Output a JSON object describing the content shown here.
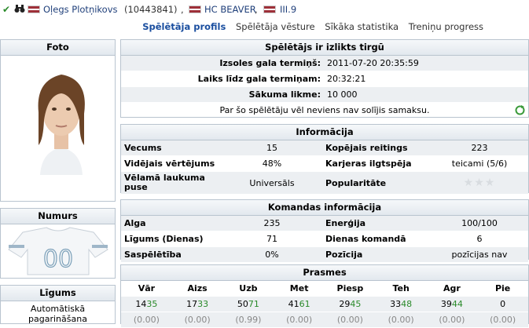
{
  "header": {
    "player_name": "Oļegs Plotņikovs",
    "player_id": "(10443841)",
    "team": "HC BEAVER",
    "league": "III.9",
    "separator": ","
  },
  "tabs": [
    {
      "label": "Spēlētāja profils",
      "active": true
    },
    {
      "label": "Spēlētāja vēsture",
      "active": false
    },
    {
      "label": "Sīkāka statistika",
      "active": false
    },
    {
      "label": "Treniņu progress",
      "active": false
    }
  ],
  "left": {
    "photo_title": "Foto",
    "number_title": "Numurs",
    "contract_title": "Līgums",
    "contract_text_1": "Automātiskā",
    "contract_text_2": "pagarināšana"
  },
  "market": {
    "title": "Spēlētājs ir izlikts tirgū",
    "rows": [
      {
        "label": "Izsoles gala termiņš:",
        "value": "2011-07-20 20:35:59"
      },
      {
        "label": "Laiks līdz gala termiņam:",
        "value": "20:32:21"
      },
      {
        "label": "Sākuma likme:",
        "value": "10 000"
      }
    ],
    "note": "Par šo spēlētāju vēl neviens nav solījis samaksu."
  },
  "info": {
    "title": "Informācija",
    "rows": [
      {
        "l1": "Vecums",
        "v1": "15",
        "l2": "Kopējais reitings",
        "v2": "223"
      },
      {
        "l1": "Vidējais vērtējums",
        "v1": "48%",
        "l2": "Karjeras ilgtspēja",
        "v2": "teicami (5/6)"
      },
      {
        "l1": "Vēlamā laukuma puse",
        "v1": "Universāls",
        "l2": "Popularitāte",
        "v2": ""
      }
    ],
    "popularity_stars": 0
  },
  "team_info": {
    "title": "Komandas informācija",
    "rows": [
      {
        "l1": "Alga",
        "v1": "235",
        "l2": "Enerģija",
        "v2": "100/100"
      },
      {
        "l1": "Līgums (Dienas)",
        "v1": "71",
        "l2": "Dienas komandā",
        "v2": "6"
      },
      {
        "l1": "Saspēlētība",
        "v1": "0%",
        "l2": "Pozīcija",
        "v2": "pozīcijas nav"
      }
    ]
  },
  "skills": {
    "title": "Prasmes",
    "cols": [
      {
        "name": "Vār",
        "base": "14",
        "add": "35",
        "sub": "(0.00)"
      },
      {
        "name": "Aizs",
        "base": "17",
        "add": "33",
        "sub": "(0.00)"
      },
      {
        "name": "Uzb",
        "base": "50",
        "add": "71",
        "sub": "(0.99)"
      },
      {
        "name": "Met",
        "base": "41",
        "add": "61",
        "sub": "(0.00)"
      },
      {
        "name": "Piesp",
        "base": "29",
        "add": "45",
        "sub": "(0.00)"
      },
      {
        "name": "Teh",
        "base": "33",
        "add": "48",
        "sub": "(0.00)"
      },
      {
        "name": "Agr",
        "base": "39",
        "add": "44",
        "sub": "(0.00)"
      },
      {
        "name": "Pie",
        "base": "0",
        "add": "",
        "sub": "(0.00)"
      }
    ]
  },
  "jersey_number": "00",
  "colors": {
    "flag": "#9e3039",
    "link": "#1f3f7a",
    "active_tab": "#1a4e9f",
    "border": "#b9c4cf",
    "skill_plus": "#2a8a2a"
  }
}
